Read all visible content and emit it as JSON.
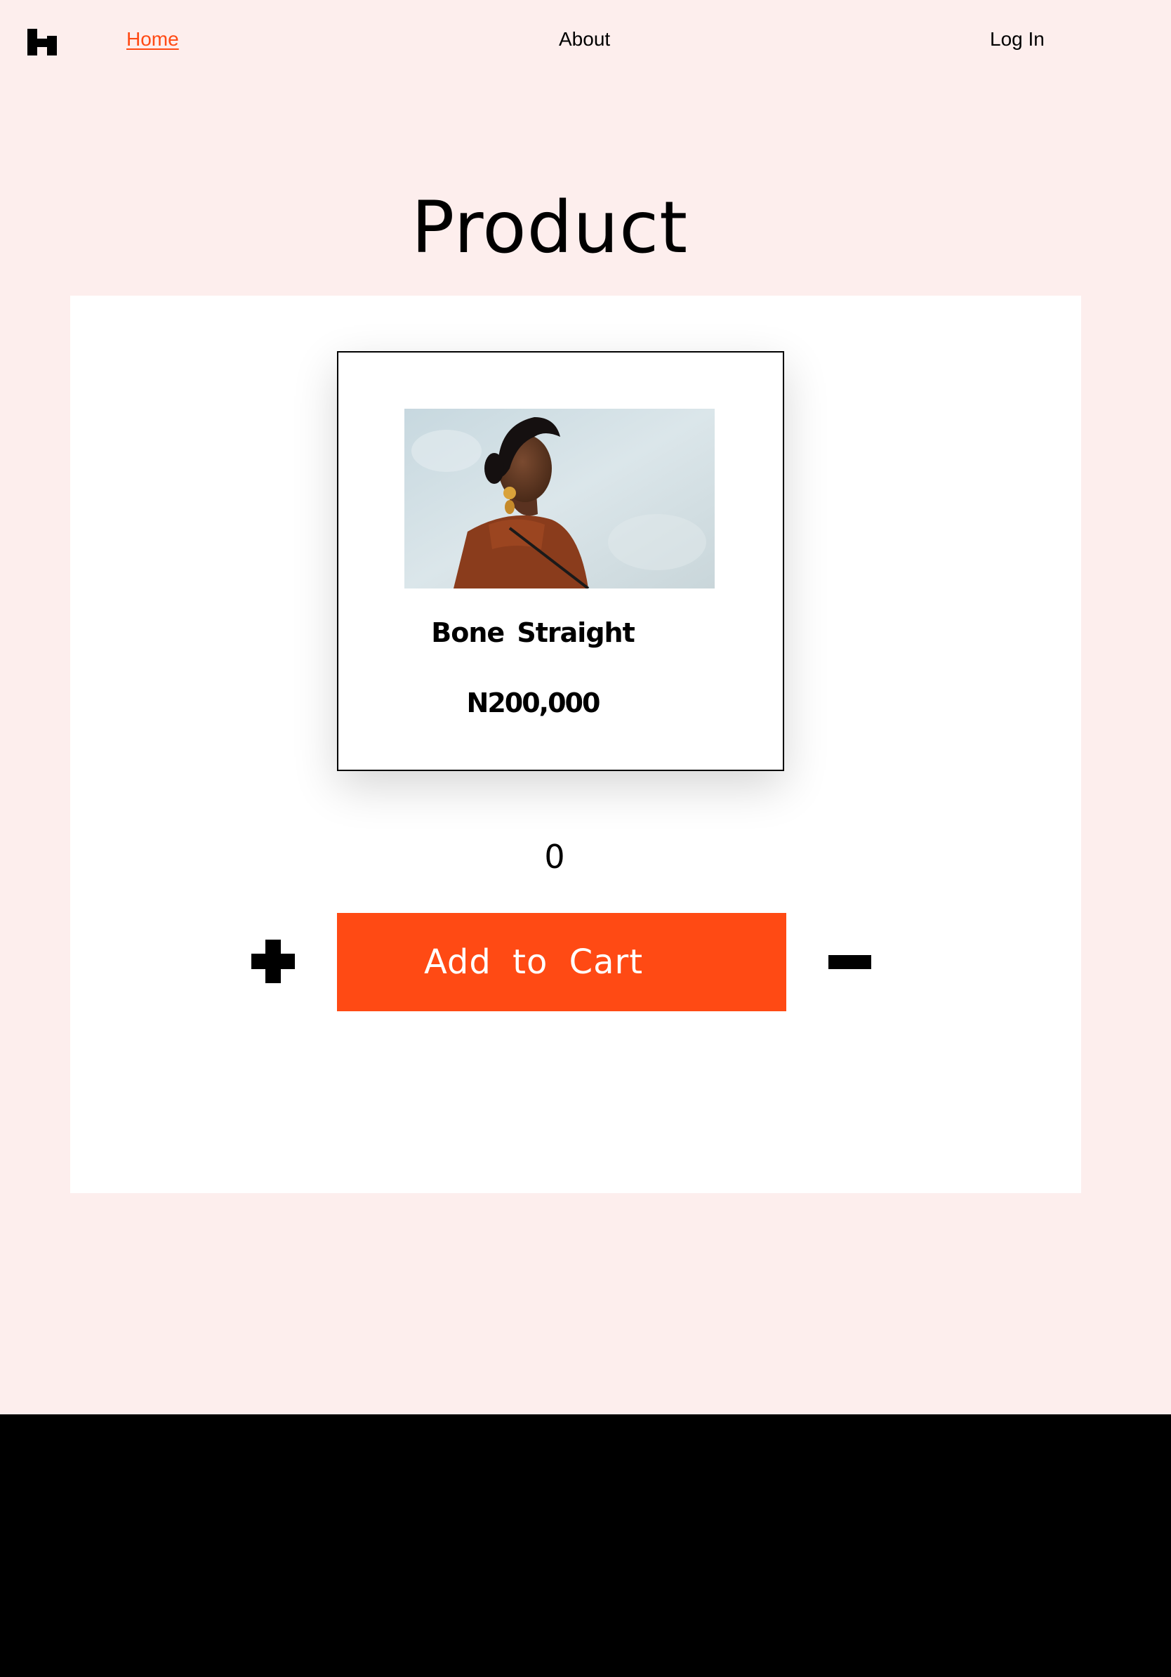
{
  "nav": {
    "home": "Home",
    "about": "About",
    "login": "Log In"
  },
  "page": {
    "title": "Product"
  },
  "product": {
    "name": "Bone Straight",
    "price": "N200,000"
  },
  "cart": {
    "quantity": "0",
    "add_label": "Add to Cart"
  },
  "colors": {
    "background": "#fdeeed",
    "accent": "#ff4a14",
    "panel": "#ffffff",
    "footer": "#000000"
  },
  "icons": {
    "logo": "h-logo-icon",
    "increment": "plus-icon",
    "decrement": "minus-icon"
  }
}
